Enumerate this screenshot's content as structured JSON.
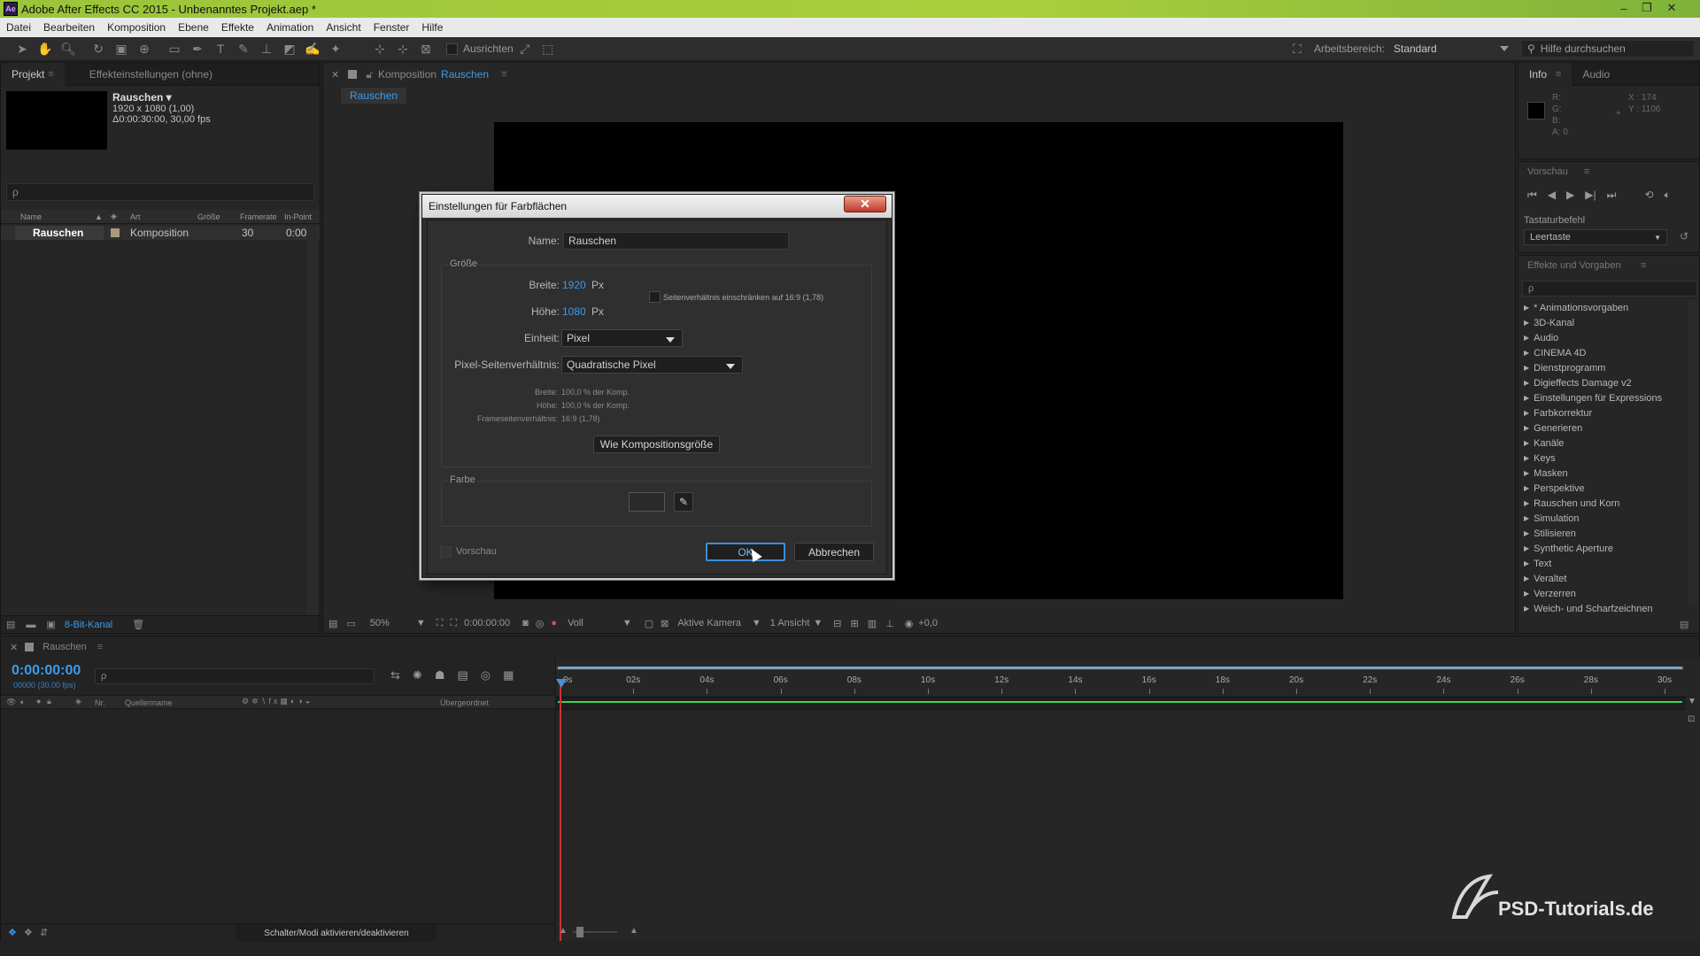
{
  "window": {
    "title": "Adobe After Effects CC 2015 - Unbenanntes Projekt.aep *",
    "logo": "Ae"
  },
  "menu": [
    "Datei",
    "Bearbeiten",
    "Komposition",
    "Ebene",
    "Effekte",
    "Animation",
    "Ansicht",
    "Fenster",
    "Hilfe"
  ],
  "toolbar": {
    "snap_label": "Ausrichten",
    "workspace_label": "Arbeitsbereich:",
    "workspace_value": "Standard",
    "help_placeholder": "Hilfe durchsuchen"
  },
  "project": {
    "tab_project": "Projekt",
    "tab_effects": "Effekteinstellungen (ohne)",
    "item_name": "Rauschen ▾",
    "item_res": "1920 x 1080 (1,00)",
    "item_dur": "Δ0:00:30:00, 30,00 fps",
    "search_placeholder": "ρ",
    "columns": [
      "Name",
      "Art",
      "Größe",
      "Framerate",
      "In-Point"
    ],
    "row": {
      "name": "Rauschen",
      "type": "Komposition",
      "fps": "30",
      "in": "0:00"
    },
    "bitdepth": "8-Bit-Kanal"
  },
  "comp": {
    "tab_prefix": "Komposition",
    "tab_name": "Rauschen",
    "subtab": "Rauschen",
    "footer": {
      "zoom": "50%",
      "time": "0:00:00:00",
      "resolution": "Voll",
      "camera": "Aktive Kamera",
      "views": "1 Ansicht",
      "exposure": "+0,0"
    }
  },
  "info": {
    "tab_info": "Info",
    "tab_audio": "Audio",
    "r": "R:",
    "g": "G:",
    "b": "B:",
    "a": "A:  0",
    "x": "X : 174",
    "y": "Y : 1106"
  },
  "preview": {
    "title": "Vorschau",
    "shortcut_label": "Tastaturbefehl",
    "shortcut_value": "Leertaste"
  },
  "effects": {
    "title": "Effekte und Vorgaben",
    "items": [
      "* Animationsvorgaben",
      "3D-Kanal",
      "Audio",
      "CINEMA 4D",
      "Dienstprogramm",
      "Digieffects Damage v2",
      "Einstellungen für Expressions",
      "Farbkorrektur",
      "Generieren",
      "Kanäle",
      "Keys",
      "Masken",
      "Perspektive",
      "Rauschen und Korn",
      "Simulation",
      "Stilisieren",
      "Synthetic Aperture",
      "Text",
      "Veraltet",
      "Verzerren",
      "Weich- und Scharfzeichnen"
    ]
  },
  "dialog": {
    "title": "Einstellungen für Farbflächen",
    "name_label": "Name:",
    "name_value": "Rauschen",
    "size_group": "Größe",
    "width_label": "Breite:",
    "width_value": "1920",
    "height_label": "Höhe:",
    "height_value": "1080",
    "px": "Px",
    "aspect_lock": "Seitenverhältnis einschränken auf 16:9 (1,78)",
    "unit_label": "Einheit:",
    "unit_value": "Pixel",
    "par_label": "Pixel-Seitenverhältnis:",
    "par_value": "Quadratische Pixel",
    "w_pct_label": "Breite:",
    "w_pct_value": "100,0 % der Komp.",
    "h_pct_label": "Höhe:",
    "h_pct_value": "100,0 % der Komp.",
    "frame_label": "Frameseitenverhältnis:",
    "frame_value": "16:9 (1,78)",
    "comp_size_button": "Wie Kompositionsgröße",
    "color_group": "Farbe",
    "color_swatch": "#2a2a2a",
    "preview_label": "Vorschau",
    "ok": "OK",
    "cancel": "Abbrechen"
  },
  "timeline": {
    "tab": "Rauschen",
    "timecode": "0:00:00:00",
    "frames": "00000 (30.00 fps)",
    "col_nr": "Nr.",
    "col_source": "Quellenname",
    "col_parent": "Übergeordnet",
    "ticks": [
      "0s",
      "02s",
      "04s",
      "06s",
      "08s",
      "10s",
      "12s",
      "14s",
      "16s",
      "18s",
      "20s",
      "22s",
      "24s",
      "26s",
      "28s",
      "30s"
    ],
    "footer": "Schalter/Modi aktivieren/deaktivieren"
  },
  "watermark": "PSD-Tutorials.de"
}
